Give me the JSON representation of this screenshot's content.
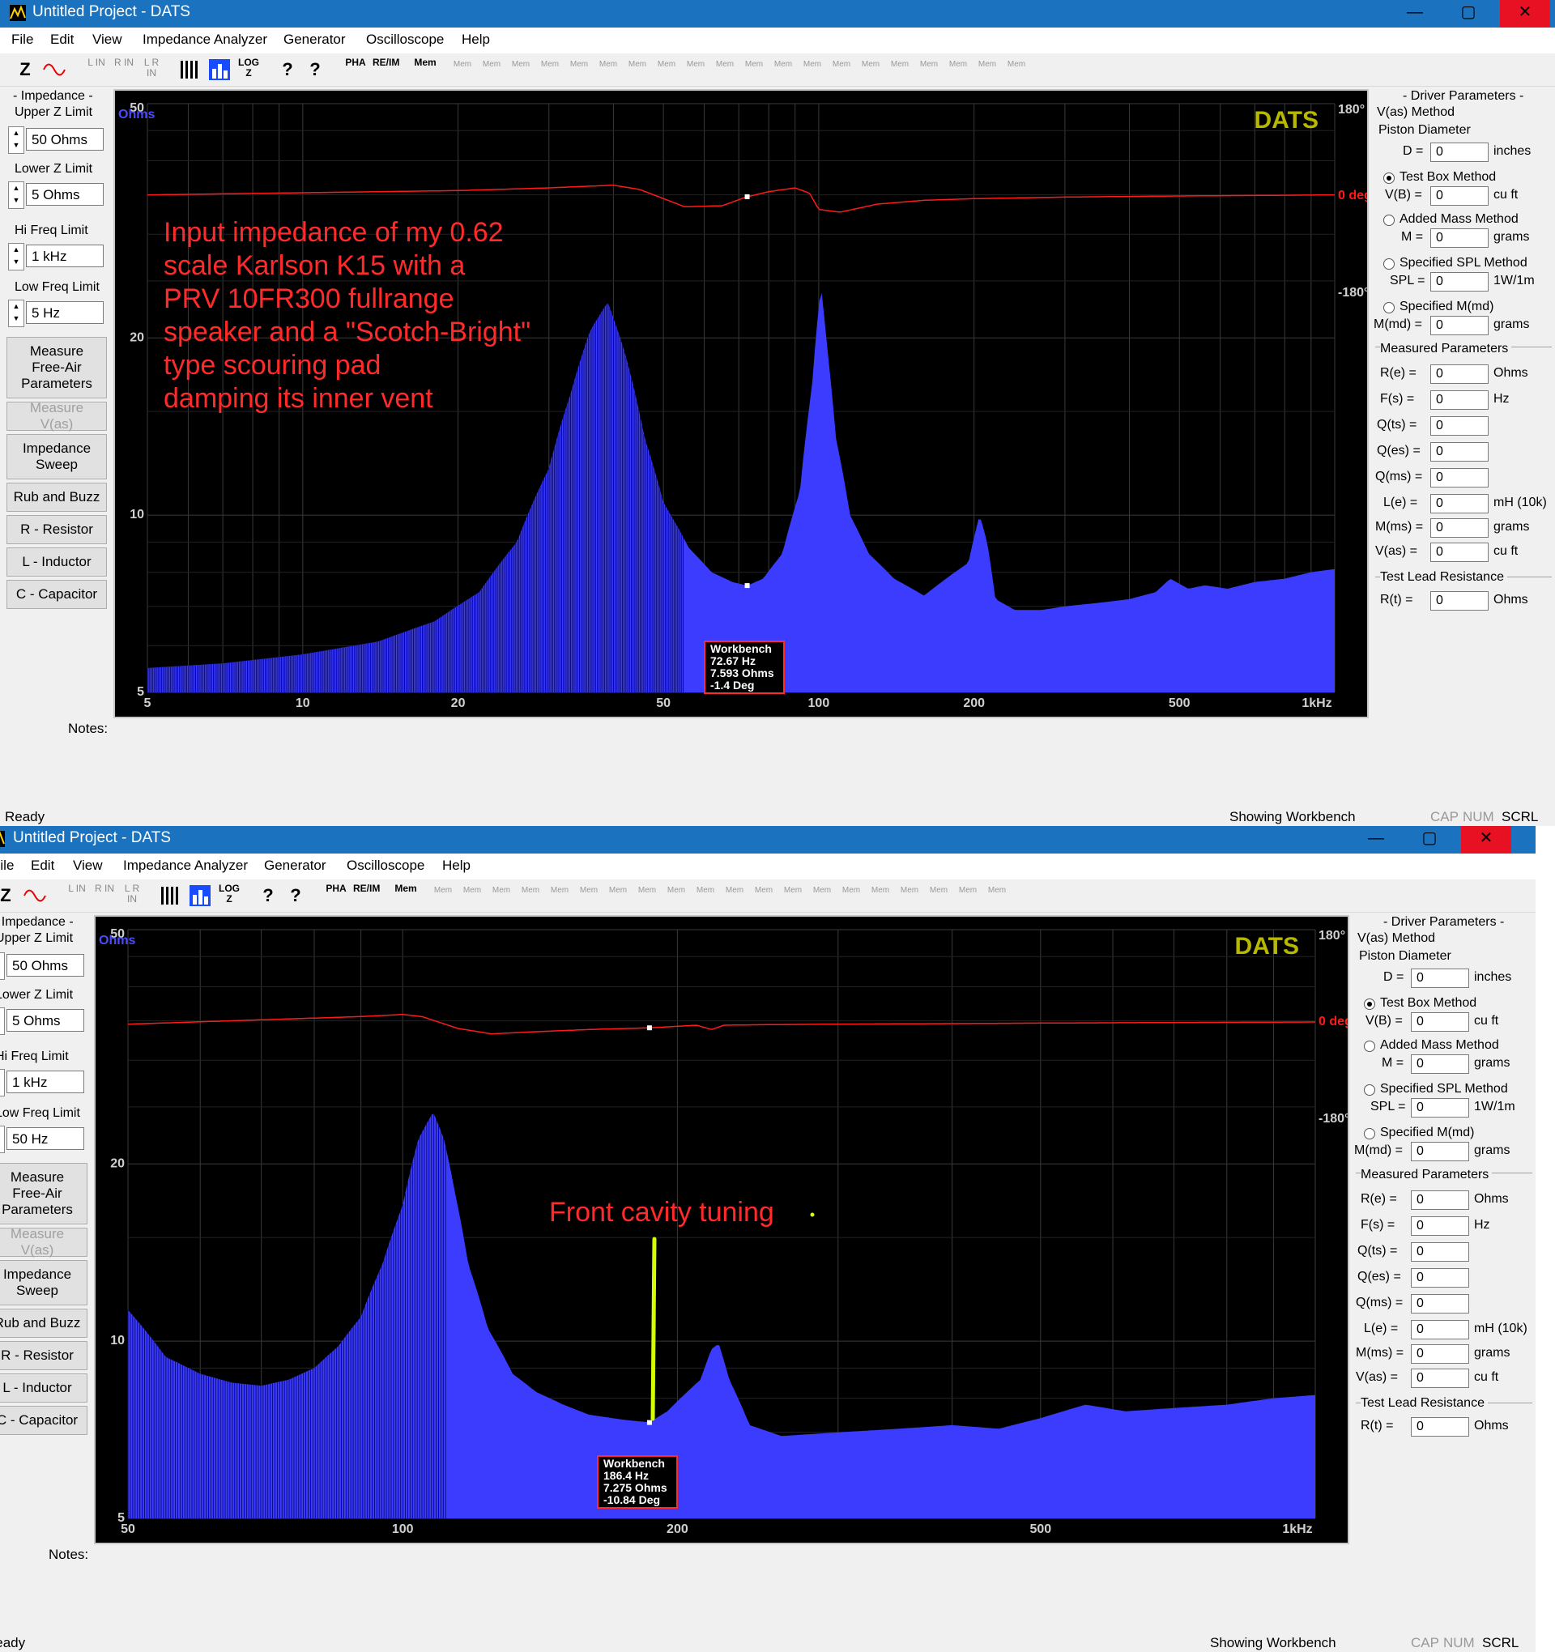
{
  "windows": [
    {
      "title": "Untitled Project - DATS",
      "menu": [
        "File",
        "Edit",
        "View",
        "Impedance Analyzer",
        "Generator",
        "Oscilloscope",
        "Help"
      ],
      "toolbar": {
        "z_label": "Z",
        "lin1": "L IN",
        "rin1": "R IN",
        "lrin": "L R IN",
        "log": "LOG Z",
        "pha": "PHA",
        "reim": "RE/IM",
        "mem": "Mem",
        "mem_slots": [
          "Mem",
          "Mem",
          "Mem",
          "Mem",
          "Mem",
          "Mem",
          "Mem",
          "Mem",
          "Mem",
          "Mem",
          "Mem",
          "Mem",
          "Mem",
          "Mem",
          "Mem",
          "Mem",
          "Mem",
          "Mem",
          "Mem",
          "Mem"
        ]
      },
      "left": {
        "impedance_group": "- Impedance -",
        "upper_label": "Upper Z Limit",
        "upper_value": "50 Ohms",
        "lower_label": "Lower Z Limit",
        "lower_value": "5 Ohms",
        "hi_label": "Hi Freq Limit",
        "hi_value": "1 kHz",
        "low_label": "Low Freq Limit",
        "low_value": "5 Hz",
        "btn_measure_free": "Measure Free-Air Parameters",
        "btn_measure_vas": "Measure V(as)",
        "btn_sweep": "Impedance Sweep",
        "btn_rub": "Rub and Buzz",
        "btn_r": "R - Resistor",
        "btn_l": "L - Inductor",
        "btn_c": "C - Capacitor"
      },
      "chart": {
        "brand": "DATS",
        "y_unit": "Ohms",
        "annotation": [
          "Input impedance of my 0.62",
          "scale Karlson K15 with a",
          "PRV 10FR300 fullrange",
          "speaker and a \"Scotch-Bright\"",
          "type scouring pad",
          "damping its inner vent"
        ],
        "readout": {
          "title": "Workbench",
          "freq": "72.67 Hz",
          "imp": "7.593 Ohms",
          "phase": "-1.4 Deg"
        }
      },
      "notes_label": "Notes:",
      "status": {
        "left": "Ready",
        "middle": "Showing Workbench",
        "cap": "CAP",
        "num": "NUM",
        "scrl": "SCRL"
      },
      "right": {
        "driver_params": "- Driver Parameters -",
        "vas_method": "V(as) Method",
        "piston_diameter": "Piston Diameter",
        "d_label": "D =",
        "d_value": "0",
        "d_unit": "inches",
        "test_box": "Test Box Method",
        "vb_label": "V(B) =",
        "vb_value": "0",
        "vb_unit": "cu ft",
        "added_mass": "Added Mass Method",
        "m_label": "M =",
        "m_value": "0",
        "m_unit": "grams",
        "spl_method": "Specified SPL Method",
        "spl_label": "SPL =",
        "spl_value": "0",
        "spl_unit": "1W/1m",
        "mmd_method": "Specified M(md)",
        "mmd_label": "M(md) =",
        "mmd_value": "0",
        "mmd_unit": "grams",
        "measured": "Measured Parameters",
        "re_label": "R(e) =",
        "re_value": "0",
        "re_unit": "Ohms",
        "fs_label": "F(s) =",
        "fs_value": "0",
        "fs_unit": "Hz",
        "qts_label": "Q(ts) =",
        "qts_value": "0",
        "qes_label": "Q(es) =",
        "qes_value": "0",
        "qms_label": "Q(ms) =",
        "qms_value": "0",
        "le_label": "L(e) =",
        "le_value": "0",
        "le_unit": "mH (10k)",
        "mms_label": "M(ms) =",
        "mms_value": "0",
        "mms_unit": "grams",
        "vas_label": "V(as) =",
        "vas_value": "0",
        "vas_unit": "cu ft",
        "lead": "Test Lead Resistance",
        "rt_label": "R(t) =",
        "rt_value": "0",
        "rt_unit": "Ohms"
      }
    },
    {
      "title": "Untitled Project - DATS",
      "menu": [
        "File",
        "Edit",
        "View",
        "Impedance Analyzer",
        "Generator",
        "Oscilloscope",
        "Help"
      ],
      "toolbar": {
        "z_label": "Z",
        "lin1": "L IN",
        "rin1": "R IN",
        "lrin": "L R IN",
        "log": "LOG Z",
        "pha": "PHA",
        "reim": "RE/IM",
        "mem": "Mem",
        "mem_slots": [
          "Mem",
          "Mem",
          "Mem",
          "Mem",
          "Mem",
          "Mem",
          "Mem",
          "Mem",
          "Mem",
          "Mem",
          "Mem",
          "Mem",
          "Mem",
          "Mem",
          "Mem",
          "Mem",
          "Mem",
          "Mem",
          "Mem",
          "Mem"
        ]
      },
      "left": {
        "impedance_group": "- Impedance -",
        "upper_label": "Upper Z Limit",
        "upper_value": "50 Ohms",
        "lower_label": "Lower Z Limit",
        "lower_value": "5 Ohms",
        "hi_label": "Hi Freq Limit",
        "hi_value": "1 kHz",
        "low_label": "Low Freq Limit",
        "low_value": "50 Hz",
        "btn_measure_free": "Measure Free-Air Parameters",
        "btn_measure_vas": "Measure V(as)",
        "btn_sweep": "Impedance Sweep",
        "btn_rub": "Rub and Buzz",
        "btn_r": "R - Resistor",
        "btn_l": "L - Inductor",
        "btn_c": "C - Capacitor"
      },
      "chart": {
        "brand": "DATS",
        "y_unit": "Ohms",
        "annotation": [
          "Front cavity tuning"
        ],
        "readout": {
          "title": "Workbench",
          "freq": "186.4 Hz",
          "imp": "7.275 Ohms",
          "phase": "-10.84 Deg"
        }
      },
      "notes_label": "Notes:",
      "status": {
        "left": "Ready",
        "middle": "Showing Workbench",
        "cap": "CAP",
        "num": "NUM",
        "scrl": "SCRL"
      },
      "right": {
        "driver_params": "- Driver Parameters -",
        "vas_method": "V(as) Method",
        "piston_diameter": "Piston Diameter",
        "d_label": "D =",
        "d_value": "0",
        "d_unit": "inches",
        "test_box": "Test Box Method",
        "vb_label": "V(B) =",
        "vb_value": "0",
        "vb_unit": "cu ft",
        "added_mass": "Added Mass Method",
        "m_label": "M =",
        "m_value": "0",
        "m_unit": "grams",
        "spl_method": "Specified SPL Method",
        "spl_label": "SPL =",
        "spl_value": "0",
        "spl_unit": "1W/1m",
        "mmd_method": "Specified M(md)",
        "mmd_label": "M(md) =",
        "mmd_value": "0",
        "mmd_unit": "grams",
        "measured": "Measured Parameters",
        "re_label": "R(e) =",
        "re_value": "0",
        "re_unit": "Ohms",
        "fs_label": "F(s) =",
        "fs_value": "0",
        "fs_unit": "Hz",
        "qts_label": "Q(ts) =",
        "qts_value": "0",
        "qes_label": "Q(es) =",
        "qes_value": "0",
        "qms_label": "Q(ms) =",
        "qms_value": "0",
        "le_label": "L(e) =",
        "le_value": "0",
        "le_unit": "mH (10k)",
        "mms_label": "M(ms) =",
        "mms_value": "0",
        "mms_unit": "grams",
        "vas_label": "V(as) =",
        "vas_value": "0",
        "vas_unit": "cu ft",
        "lead": "Test Lead Resistance",
        "rt_label": "R(t) =",
        "rt_value": "0",
        "rt_unit": "Ohms"
      }
    }
  ],
  "chart_data": [
    {
      "type": "area",
      "x_scale": "log",
      "y_scale": "log",
      "xlim": [
        5,
        1000
      ],
      "ylim": [
        5,
        50
      ],
      "x_ticks": [
        "5",
        "10",
        "20",
        "50",
        "100",
        "200",
        "500",
        "1kHz"
      ],
      "x_tick_values": [
        5,
        10,
        20,
        50,
        100,
        200,
        500,
        1000
      ],
      "y_ticks": [
        "50",
        "20",
        "10",
        "5"
      ],
      "y_tick_values": [
        50,
        20,
        10,
        5
      ],
      "phase_ticks": [
        "180°",
        "0 deg",
        "-180°"
      ],
      "phase_tick_values": [
        180,
        0,
        -180
      ],
      "grid": true,
      "impedance": {
        "x": [
          5,
          7,
          10,
          14,
          18,
          22,
          26,
          30,
          33,
          36,
          39,
          42,
          46,
          50,
          56,
          62,
          68,
          72.67,
          78,
          85,
          92,
          97,
          101,
          104,
          108,
          115,
          125,
          140,
          160,
          180,
          195,
          205,
          212,
          220,
          240,
          270,
          300,
          350,
          400,
          450,
          480,
          520,
          560,
          620,
          700,
          800,
          900,
          1000
        ],
        "y": [
          5.5,
          5.6,
          5.8,
          6.1,
          6.6,
          7.4,
          9.0,
          12.0,
          16.0,
          20.5,
          23.0,
          19.0,
          13.5,
          10.5,
          8.8,
          8.0,
          7.7,
          7.59,
          7.8,
          8.6,
          11.0,
          16.5,
          24.5,
          19.0,
          13.5,
          10.0,
          8.6,
          7.8,
          7.3,
          7.9,
          8.3,
          10.0,
          9.0,
          7.2,
          6.9,
          6.9,
          7.0,
          7.1,
          7.2,
          7.4,
          7.8,
          7.5,
          7.6,
          7.5,
          7.7,
          7.8,
          8.0,
          8.1
        ]
      },
      "phase": {
        "x": [
          5,
          10,
          20,
          30,
          40,
          45,
          55,
          65,
          72.67,
          80,
          90,
          96,
          100,
          110,
          130,
          160,
          200,
          300,
          500,
          1000
        ],
        "y": [
          2,
          6,
          10,
          15,
          20,
          12,
          -20,
          -18,
          -1.4,
          8,
          15,
          5,
          -25,
          -30,
          -15,
          -8,
          -5,
          -2,
          0,
          2
        ]
      },
      "cursor": {
        "x": 72.67,
        "y": 7.593,
        "phase": -1.4
      }
    },
    {
      "type": "area",
      "x_scale": "log",
      "y_scale": "log",
      "xlim": [
        50,
        1000
      ],
      "ylim": [
        5,
        50
      ],
      "x_ticks": [
        "50",
        "100",
        "200",
        "500",
        "1kHz"
      ],
      "x_tick_values": [
        50,
        100,
        200,
        500,
        1000
      ],
      "y_ticks": [
        "50",
        "20",
        "10",
        "5"
      ],
      "y_tick_values": [
        50,
        20,
        10,
        5
      ],
      "phase_ticks": [
        "180°",
        "0 deg",
        "-180°"
      ],
      "phase_tick_values": [
        180,
        0,
        -180
      ],
      "grid": true,
      "impedance": {
        "x": [
          50,
          55,
          60,
          65,
          70,
          75,
          80,
          85,
          90,
          95,
          100,
          104,
          108,
          111,
          114,
          118,
          124,
          132,
          140,
          150,
          160,
          175,
          186.4,
          195,
          205,
          212,
          218,
          222,
          228,
          240,
          260,
          300,
          350,
          400,
          450,
          500,
          560,
          620,
          700,
          800,
          900,
          1000
        ],
        "y": [
          11.3,
          9.4,
          8.8,
          8.5,
          8.4,
          8.6,
          9.0,
          9.8,
          11.0,
          13.5,
          17.0,
          22.0,
          24.5,
          22.0,
          18.0,
          13.5,
          10.5,
          8.8,
          8.2,
          7.8,
          7.5,
          7.35,
          7.28,
          7.6,
          8.2,
          8.6,
          9.7,
          9.9,
          8.6,
          7.2,
          6.9,
          7.0,
          7.1,
          7.2,
          7.1,
          7.4,
          7.8,
          7.6,
          7.7,
          7.8,
          8.0,
          8.1
        ]
      },
      "phase": {
        "x": [
          50,
          70,
          90,
          100,
          105,
          115,
          125,
          140,
          160,
          186.4,
          210,
          218,
          225,
          250,
          300,
          400,
          500,
          700,
          1000
        ],
        "y": [
          -4,
          4,
          10,
          14,
          10,
          -12,
          -22,
          -18,
          -14,
          -10.84,
          -6,
          -14,
          -6,
          -5,
          -4,
          -3,
          -2,
          -1,
          0
        ]
      },
      "cursor": {
        "x": 186.4,
        "y": 7.275,
        "phase": -10.84
      }
    }
  ],
  "colors": {
    "titlebar": "#1b73bf",
    "impedance_fill": "#3c3cff",
    "phase_line": "#ff1a1a",
    "annotation": "#ff2a2a",
    "brand": "#b8b800",
    "cursor_box_border": "#ff2a2a",
    "marker_line": "#d4ff00"
  }
}
